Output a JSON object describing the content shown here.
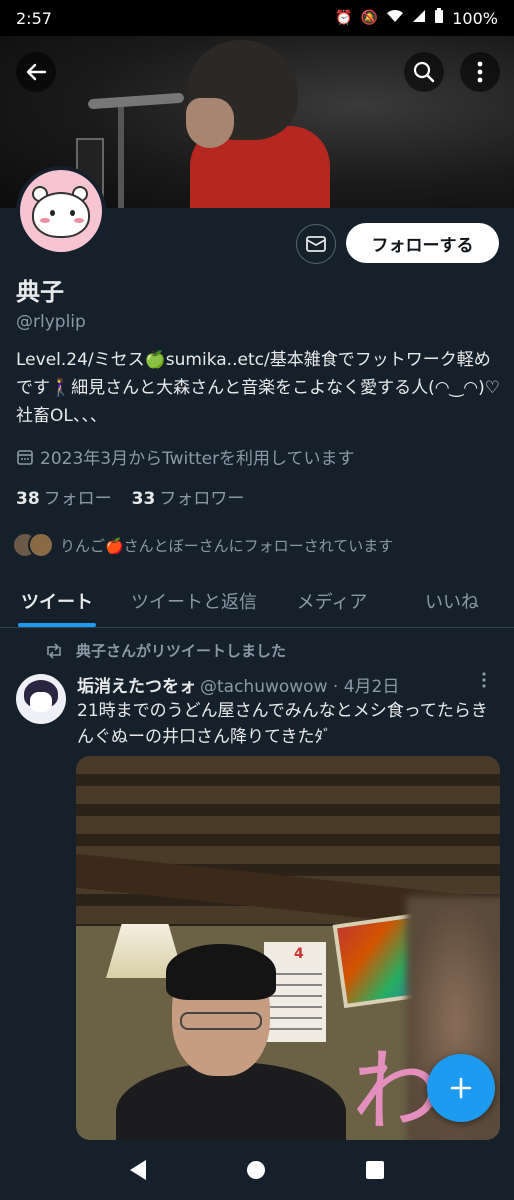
{
  "status_bar": {
    "time": "2:57",
    "battery": "100%"
  },
  "profile": {
    "follow_button": "フォローする",
    "name": "典子",
    "handle": "@rlyplip",
    "bio": "Level.24/ミセス🍏sumika..etc/基本雑食でフットワーク軽めです🚶‍♀️細見さんと大森さんと音楽をこよなく愛する人(◠‿◠)♡社畜OL、、、",
    "joined": "2023年3月からTwitterを利用しています",
    "following_count": "38",
    "following_label": "フォロー",
    "followers_count": "33",
    "followers_label": "フォロワー",
    "followers_you_know": "りんご🍎さんとぼーさんにフォローされています"
  },
  "tabs": [
    {
      "label": "ツイート",
      "active": true
    },
    {
      "label": "ツイートと返信",
      "active": false
    },
    {
      "label": "メディア",
      "active": false
    },
    {
      "label": "いいね",
      "active": false
    }
  ],
  "tweet": {
    "retweeted_by": "典子さんがリツイートしました",
    "author_name": "垢消えたつをォ",
    "author_meta": "@tachuwowow · 4月2日",
    "text": "21時までのうどん屋さんでみんなとメシ食ってたらきんぐぬーの井口さん降りてきたﾀﾞ",
    "photo": {
      "calendar_month": "4",
      "scribble": "わ"
    }
  },
  "colors": {
    "background": "#15202b",
    "accent": "#1d9bf0",
    "secondary_text": "#8b98a5"
  }
}
